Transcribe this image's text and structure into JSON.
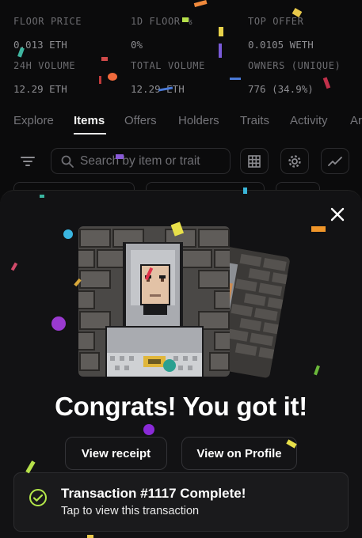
{
  "stats": [
    {
      "label": "FLOOR PRICE",
      "value": "0.013 ETH"
    },
    {
      "label": "1D FLOOR %",
      "value": "0%"
    },
    {
      "label": "TOP OFFER",
      "value": "0.0105 WETH"
    },
    {
      "label": "24H VOLUME",
      "value": "12.29 ETH"
    },
    {
      "label": "TOTAL VOLUME",
      "value": "12.29 ETH"
    },
    {
      "label": "OWNERS (UNIQUE)",
      "value": "776 (34.9%)"
    }
  ],
  "tabs": [
    "Explore",
    "Items",
    "Offers",
    "Holders",
    "Traits",
    "Activity",
    "Ar"
  ],
  "active_tab": "Items",
  "search": {
    "placeholder": "Search by item or trait"
  },
  "modal": {
    "title": "Congrats! You got it!",
    "view_receipt": "View receipt",
    "view_profile": "View on Profile"
  },
  "toast": {
    "title": "Transaction #1117 Complete!",
    "subtitle": "Tap to view this transaction"
  },
  "colors": {
    "accent_check": "#b4e84a",
    "text": "#ffffff",
    "muted": "#6c6c70"
  }
}
